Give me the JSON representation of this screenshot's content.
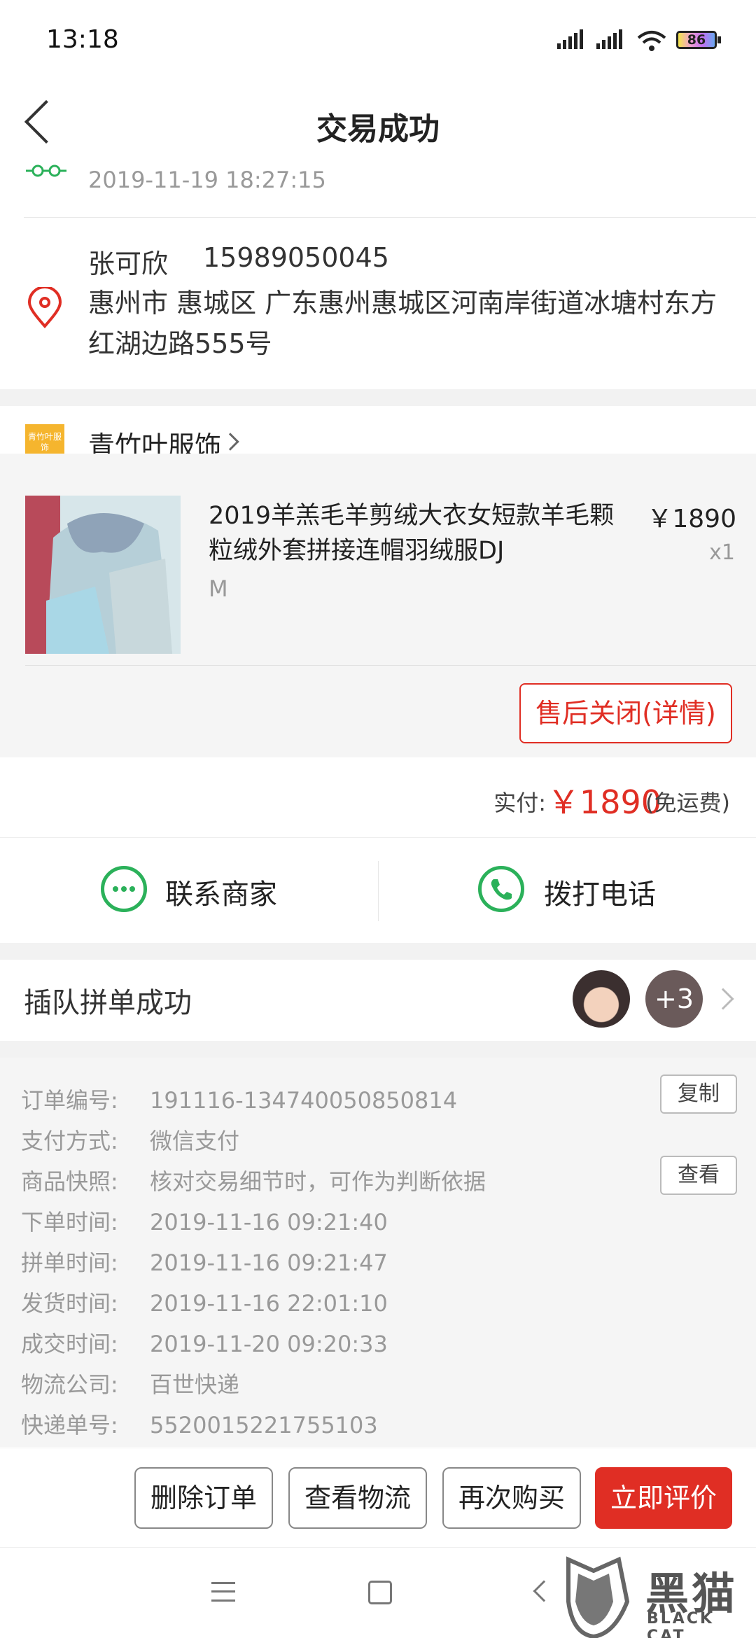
{
  "status_bar": {
    "time": "13:18",
    "battery": "86"
  },
  "header": {
    "title": "交易成功"
  },
  "delivery": {
    "icon": "delivered-status-icon",
    "time": "2019-11-19 18:27:15"
  },
  "recipient": {
    "name": "张可欣",
    "phone": "15989050045",
    "address": "惠州市 惠城区 广东惠州惠城区河南岸街道冰塘村东方红湖边路555号"
  },
  "shop": {
    "name": "青竹叶服饰",
    "logo_text": "青竹叶服饰"
  },
  "product": {
    "name": "2019羊羔毛羊剪绒大衣女短款羊毛颗粒绒外套拼接连帽羽绒服DJ",
    "price": "￥1890",
    "qty": "x1",
    "spec": "M",
    "aftersale_label": "售后关闭(详情)"
  },
  "payment": {
    "label": "实付:",
    "amount": "￥1890",
    "note": "(免运费)"
  },
  "actions": {
    "contact_label": "联系商家",
    "call_label": "拨打电话"
  },
  "group_buy": {
    "label": "插队拼单成功",
    "extra_count": "+3"
  },
  "order_info": {
    "rows": [
      {
        "label": "订单编号:",
        "value": "191116-134740050850814"
      },
      {
        "label": "支付方式:",
        "value": "微信支付"
      },
      {
        "label": "商品快照:",
        "value": "核对交易细节时，可作为判断依据"
      },
      {
        "label": "下单时间:",
        "value": "2019-11-16 09:21:40"
      },
      {
        "label": "拼单时间:",
        "value": "2019-11-16 09:21:47"
      },
      {
        "label": "发货时间:",
        "value": "2019-11-16 22:01:10"
      },
      {
        "label": "成交时间:",
        "value": "2019-11-20 09:20:33"
      },
      {
        "label": "物流公司:",
        "value": "百世快递"
      },
      {
        "label": "快递单号:",
        "value": "5520015221755103"
      }
    ],
    "copy_label": "复制",
    "view_label": "查看"
  },
  "bottom_actions": {
    "delete": "删除订单",
    "logistics": "查看物流",
    "rebuy": "再次购买",
    "rate": "立即评价"
  },
  "watermark": {
    "text": "黑猫",
    "sub": "BLACK CAT"
  },
  "colors": {
    "accent": "#e02e24",
    "green": "#2bb15a"
  }
}
